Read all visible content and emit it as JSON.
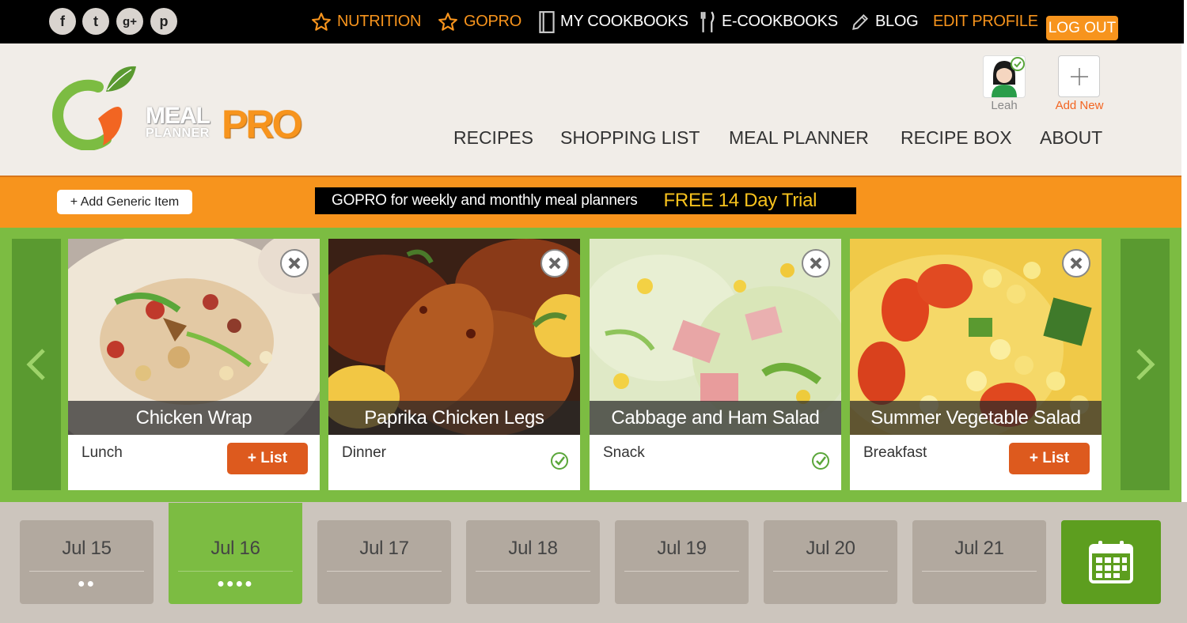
{
  "topbar": {
    "social": [
      {
        "icon": "facebook-icon",
        "glyph": "f"
      },
      {
        "icon": "twitter-icon",
        "glyph": "t"
      },
      {
        "icon": "google-plus-icon",
        "glyph": "g+"
      },
      {
        "icon": "pinterest-icon",
        "glyph": "p"
      }
    ],
    "nav": {
      "nutrition": "NUTRITION",
      "gopro": "GOPRO",
      "my_cookbooks": "MY COOKBOOKS",
      "e_cookbooks": "E-COOKBOOKS",
      "blog": "BLOG",
      "edit_profile": "EDIT PROFILE",
      "log_out": "LOG OUT"
    }
  },
  "header": {
    "logo": {
      "meal": "MEAL",
      "planner": "PLANNER",
      "pro": "PRO"
    },
    "main_nav": {
      "recipes": "RECIPES",
      "shopping_list": "SHOPPING LIST",
      "meal_planner": "MEAL PLANNER",
      "recipe_box": "RECIPE BOX",
      "about": "ABOUT"
    },
    "user": {
      "name": "Leah"
    },
    "add_new": {
      "label": "Add New",
      "icon": "plus-icon"
    }
  },
  "actionbar": {
    "add_generic": "+ Add Generic Item",
    "promo_text": "GOPRO for weekly and monthly meal planners",
    "promo_trial": "FREE 14 Day Trial"
  },
  "cards": [
    {
      "title": "Chicken Wrap",
      "meal": "Lunch",
      "action": "+ List",
      "added": false
    },
    {
      "title": "Paprika Chicken Legs",
      "meal": "Dinner",
      "action": "",
      "added": true
    },
    {
      "title": "Cabbage and Ham Salad",
      "meal": "Snack",
      "action": "",
      "added": true
    },
    {
      "title": "Summer Vegetable Salad",
      "meal": "Breakfast",
      "action": "+ List",
      "added": false
    }
  ],
  "dates": [
    {
      "label": "Jul 15",
      "dots": "●●",
      "active": false
    },
    {
      "label": "Jul 16",
      "dots": "●●●●",
      "active": true
    },
    {
      "label": "Jul 17",
      "dots": "",
      "active": false
    },
    {
      "label": "Jul 18",
      "dots": "",
      "active": false
    },
    {
      "label": "Jul 19",
      "dots": "",
      "active": false
    },
    {
      "label": "Jul 20",
      "dots": "",
      "active": false
    },
    {
      "label": "Jul 21",
      "dots": "",
      "active": false
    }
  ],
  "colors": {
    "orange": "#f7941d",
    "green": "#7cbc42",
    "dark_green": "#5a9a30",
    "list_button": "#dd5a1e",
    "date_tab": "#b2a99f"
  }
}
